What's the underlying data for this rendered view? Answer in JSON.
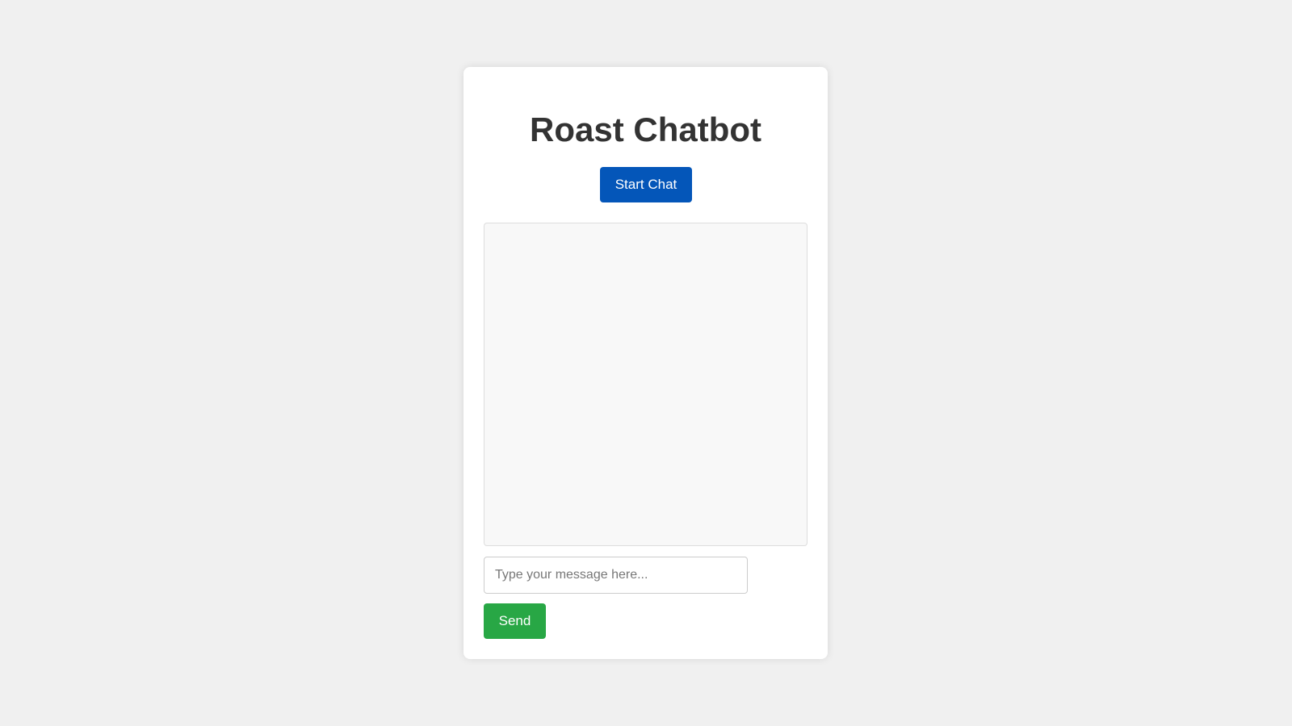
{
  "app": {
    "title": "Roast Chatbot"
  },
  "controls": {
    "start_label": "Start Chat",
    "send_label": "Send"
  },
  "chat": {
    "messages": []
  },
  "input": {
    "placeholder": "Type your message here...",
    "value": ""
  },
  "colors": {
    "page_background": "#f0f0f0",
    "card_background": "#ffffff",
    "title_text": "#333333",
    "start_button": "#0456b9",
    "send_button": "#28a745",
    "chat_background": "#f8f8f8"
  }
}
